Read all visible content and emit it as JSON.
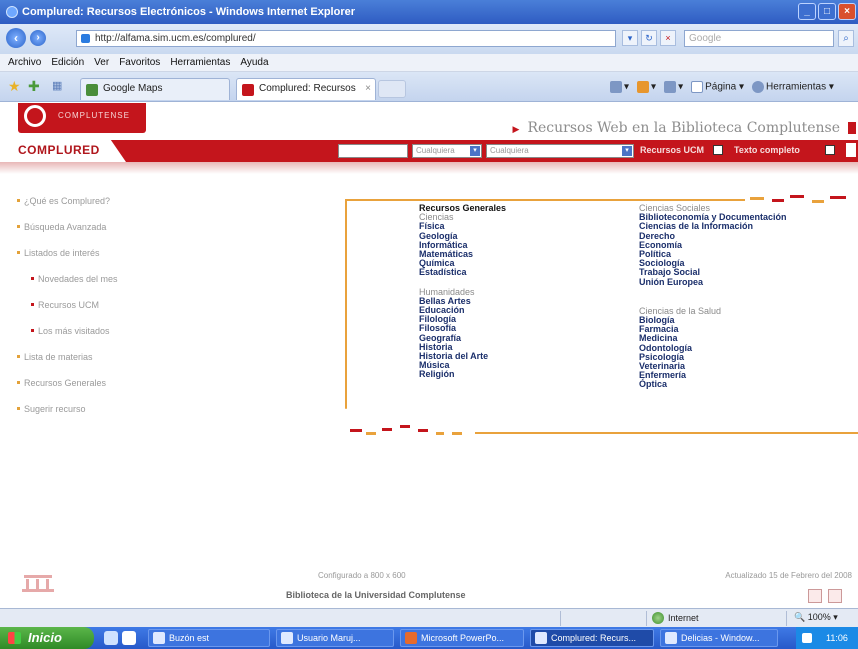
{
  "window": {
    "title": "Complured: Recursos Electrónicos - Windows Internet Explorer",
    "buttons": [
      "_",
      "□",
      "×"
    ]
  },
  "address_bar": {
    "url": "http://alfama.sim.ucm.es/complured/",
    "search_placeholder": "Google",
    "icons": [
      "dropdown-icon",
      "refresh-icon",
      "stop-icon"
    ]
  },
  "menu": [
    "Archivo",
    "Edición",
    "Ver",
    "Favoritos",
    "Herramientas",
    "Ayuda"
  ],
  "tabs": [
    {
      "label": "Google Maps",
      "active": false
    },
    {
      "label": "Complured: Recursos Ele...",
      "active": true,
      "close": "×"
    }
  ],
  "toolbar_right": {
    "pagina": "Página",
    "herramientas": "Herramientas"
  },
  "header": {
    "logo_text": "COMPLUTENSE",
    "site_title": "Recursos Web en la Biblioteca Complutense",
    "brand": "COMPLURED",
    "select1": "Cualquiera",
    "select2": "Cualquiera",
    "option1": "Recursos UCM",
    "option2": "Texto completo"
  },
  "left_nav": [
    {
      "label": "¿Qué es Complured?",
      "sub": false
    },
    {
      "label": "Búsqueda Avanzada",
      "sub": false
    },
    {
      "label": "Listados de interés",
      "sub": false
    },
    {
      "label": "Novedades del mes",
      "sub": true
    },
    {
      "label": "Recursos UCM",
      "sub": true
    },
    {
      "label": "Los más visitados",
      "sub": true
    },
    {
      "label": "Lista de materias",
      "sub": false
    },
    {
      "label": "Recursos Generales",
      "sub": false
    },
    {
      "label": "Sugerir recurso",
      "sub": false
    }
  ],
  "col1": {
    "heading": "Recursos Generales",
    "group1_heading": "Ciencias",
    "group1": [
      "Física",
      "Geología",
      "Informática",
      "Matemáticas",
      "Química",
      "Estadística"
    ],
    "group2_heading": "Humanidades",
    "group2": [
      "Bellas Artes",
      "Educación",
      "Filología",
      "Filosofía",
      "Geografía",
      "Historia",
      "Historia del Arte",
      "Música",
      "Religión"
    ]
  },
  "col2": {
    "group1_heading": "Ciencias Sociales",
    "group1": [
      "Biblioteconomía y Documentación",
      "Ciencias de la Información",
      "Derecho",
      "Economía",
      "Política",
      "Sociología",
      "Trabajo Social",
      "Unión Europea"
    ],
    "group2_heading": "Ciencias de la Salud",
    "group2": [
      "Biología",
      "Farmacia",
      "Medicina",
      "Odontología",
      "Psicología",
      "Veterinaria",
      "Enfermería",
      "Óptica"
    ]
  },
  "footer": {
    "note": "Configurado a 800 x 600",
    "date": "Actualizado 15 de Febrero del 2008",
    "library": "Biblioteca de la Universidad Complutense"
  },
  "status": {
    "zone": "Internet",
    "zoom": "100%"
  },
  "taskbar": {
    "start": "Inicio",
    "tasks": [
      "Buzón est",
      "Usuario Maruj...",
      "Microsoft PowerPo...",
      "Complured: Recurs...",
      "Delicias - Window..."
    ],
    "tray_time": "11:06"
  },
  "colors": {
    "brand_red": "#c4151c",
    "frame_orange": "#e9a23c",
    "link_navy": "#1b2f6b"
  }
}
